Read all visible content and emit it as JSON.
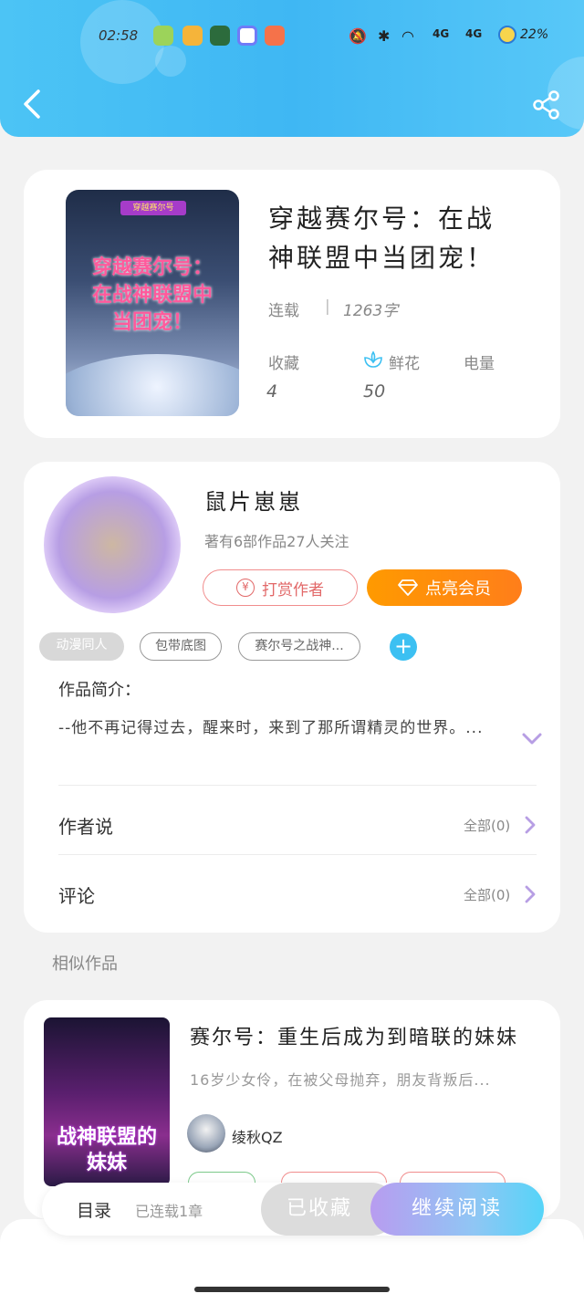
{
  "status_bar": {
    "time": "02:58",
    "battery": "22%",
    "network_1": "4G",
    "network_2": "4G"
  },
  "colors": {
    "header": "#4cc4f5",
    "accent_orange": "#ff8a0a",
    "accent_blue": "#3cc0f2",
    "tip_red": "#e26868"
  },
  "book": {
    "title": "穿越赛尔号：在战神联盟中当团宠！",
    "cover_badge": "穿越赛尔号",
    "cover_title": "穿越赛尔号：在战神联盟中当团宠！",
    "status": "连载",
    "word_count": "1263字",
    "stats": {
      "favorites_label": "收藏",
      "favorites_value": "4",
      "flowers_label": "鲜花",
      "flowers_value": "50",
      "power_label": "电量",
      "power_value": ""
    }
  },
  "author": {
    "name": "鼠片崽崽",
    "summary": "著有6部作品27人关注",
    "tip_label": "打赏作者",
    "vip_label": "点亮会员"
  },
  "tags": [
    "动漫同人",
    "包带底图",
    "赛尔号之战神..."
  ],
  "intro": {
    "heading": "作品简介：",
    "text": "--他不再记得过去，醒来时，来到了那所谓精灵的世界。..."
  },
  "rows": {
    "author_says": "作者说",
    "author_says_count": "全部(0)",
    "comments": "评论",
    "comments_count": "全部(0)"
  },
  "similar": {
    "heading": "相似作品",
    "title": "赛尔号：重生后成为到暗联的妹妹",
    "desc": "16岁少女伶，在被父母抛弃，朋友背叛后...",
    "author": "绫秋QZ",
    "cover_title": "战神联盟的妹妹"
  },
  "bottom_bar": {
    "toc": "目录",
    "chapters": "已连载1章",
    "favorited": "已收藏",
    "continue": "继续阅读"
  }
}
